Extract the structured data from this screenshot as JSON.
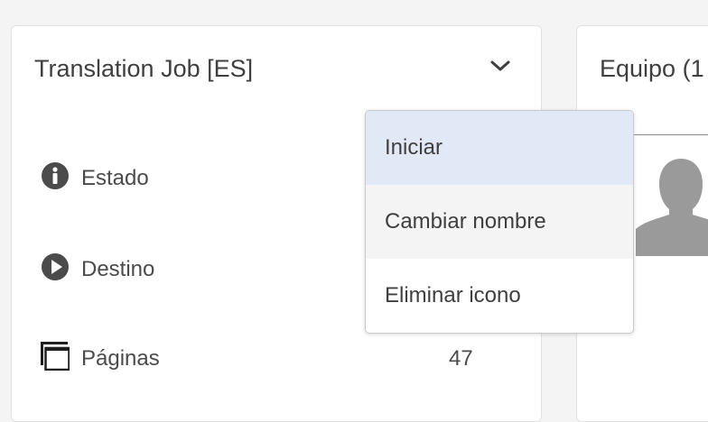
{
  "job_card": {
    "title": "Translation Job [ES]",
    "toggle_icon": "chevron-down-icon",
    "rows": [
      {
        "icon": "info-icon",
        "label": "Estado",
        "value": ""
      },
      {
        "icon": "play-icon",
        "label": "Destino",
        "value": ""
      },
      {
        "icon": "pages-icon",
        "label": "Páginas",
        "value": "47"
      }
    ]
  },
  "team_card": {
    "title": "Equipo (1",
    "avatar_icon": "user-silhouette-icon"
  },
  "dropdown_menu": {
    "items": [
      {
        "label": "Iniciar",
        "state": "selected"
      },
      {
        "label": "Cambiar nombre",
        "state": "hover"
      },
      {
        "label": "Eliminar icono",
        "state": "normal"
      }
    ]
  },
  "colors": {
    "background": "#f4f4f4",
    "card": "#ffffff",
    "selected_item": "#e1e8f6",
    "hover_item": "#f4f4f4",
    "icon": "#4b4b4b",
    "avatar": "#9a9a9a"
  }
}
